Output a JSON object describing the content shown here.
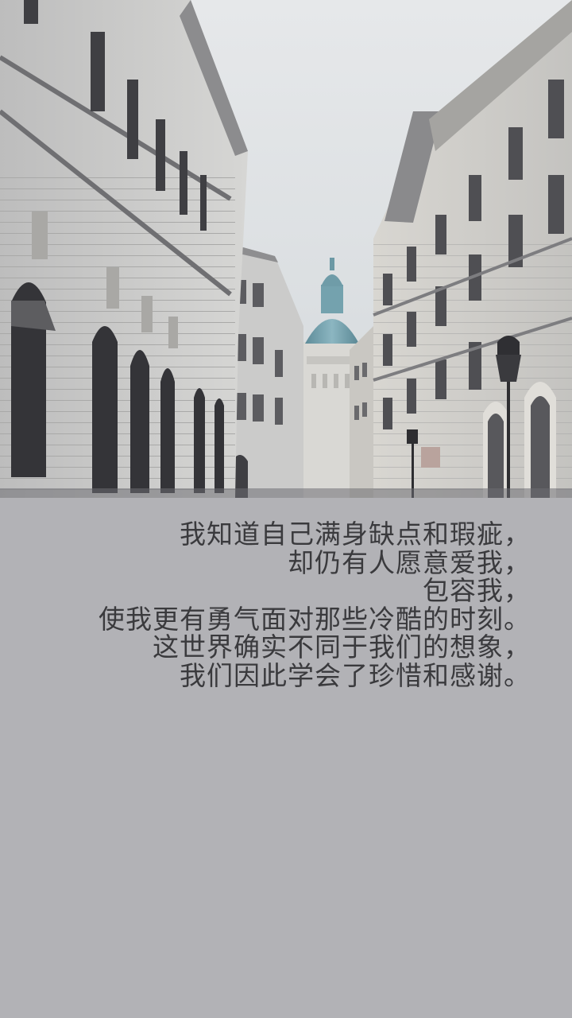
{
  "photo": {
    "subject": "street-scene-photo",
    "colors": {
      "sky": "#dfe3e6",
      "building_light": "#cfcfcf",
      "building_dark": "#7a7a7d",
      "dome": "#6a9aa8",
      "background_panel": "#b2b2b6"
    }
  },
  "poem": {
    "lines": [
      "我知道自己满身缺点和瑕疵，",
      "却仍有人愿意爱我，",
      "包容我，",
      "使我更有勇气面对那些冷酷的时刻。",
      "这世界确实不同于我们的想象，",
      "我们因此学会了珍惜和感谢。"
    ],
    "text_color": "#3a3a3d"
  }
}
